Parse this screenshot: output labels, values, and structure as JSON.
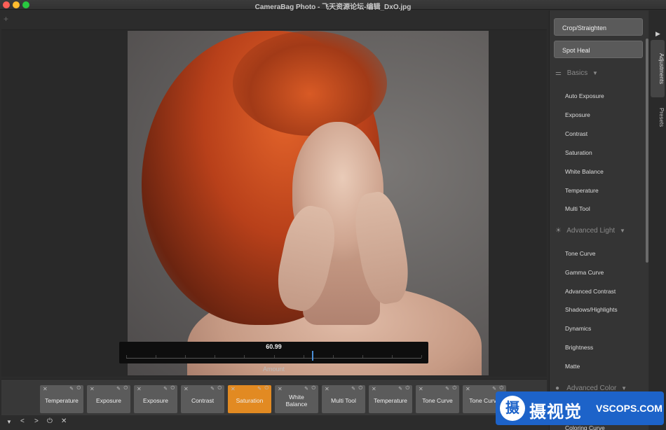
{
  "window": {
    "title": "CameraBag Photo - 飞天资源论坛-编辑_DxO.jpg"
  },
  "toolbar": {
    "add_label": "+"
  },
  "slider": {
    "value": "60.99",
    "label": "Amount",
    "position_fraction": 0.63
  },
  "sidebar": {
    "crop_label": "Crop/Straighten",
    "spot_heal_label": "Spot Heal",
    "sections": [
      {
        "title": "Basics",
        "icon": "sliders-icon",
        "items": [
          "Auto Exposure",
          "Exposure",
          "Contrast",
          "Saturation",
          "White Balance",
          "Temperature",
          "Multi Tool"
        ]
      },
      {
        "title": "Advanced Light",
        "icon": "sun-icon",
        "items": [
          "Tone Curve",
          "Gamma Curve",
          "Advanced Contrast",
          "Shadows/Highlights",
          "Dynamics",
          "Brightness",
          "Matte"
        ]
      },
      {
        "title": "Advanced Color",
        "icon": "palette-icon",
        "items": [
          "Coloring Curve"
        ]
      }
    ]
  },
  "tabs": {
    "adjustments": "Adjustments",
    "presets": "Presets"
  },
  "adjustment_strip": [
    {
      "label": "Temperature",
      "active": false
    },
    {
      "label": "Exposure",
      "active": false
    },
    {
      "label": "Exposure",
      "active": false
    },
    {
      "label": "Contrast",
      "active": false
    },
    {
      "label": "Saturation",
      "active": true
    },
    {
      "label": "White Balance",
      "active": false
    },
    {
      "label": "Multi Tool",
      "active": false
    },
    {
      "label": "Temperature",
      "active": false
    },
    {
      "label": "Tone Curve",
      "active": false
    },
    {
      "label": "Tone Curve",
      "active": false
    }
  ],
  "bottom_controls": {
    "menu": "▼",
    "prev": "<",
    "next": ">",
    "power": "⏻",
    "clear": "✕"
  },
  "watermark": {
    "logo": "摄",
    "text_cn": "摄视觉",
    "text_en": "VSCOPS.COM"
  },
  "colors": {
    "accent": "#e28a22",
    "slider_thumb": "#4a8fd8",
    "watermark_bg": "#1d63c9"
  }
}
